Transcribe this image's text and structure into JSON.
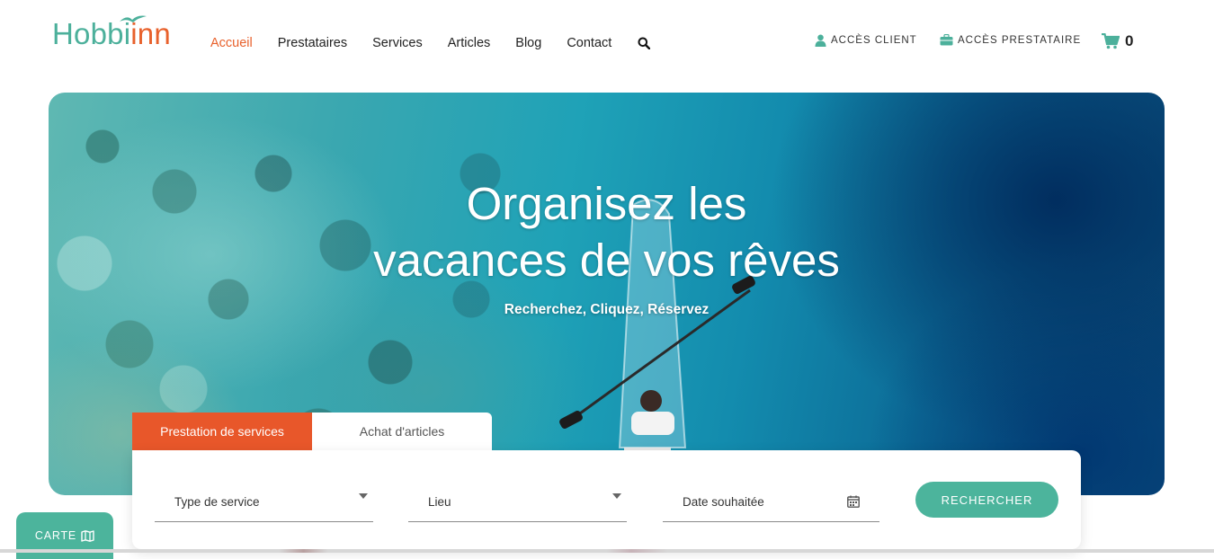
{
  "brand": {
    "logo_part1": "Hobbi",
    "logo_part2": "inn",
    "primary_color": "#4cb09b",
    "accent_color": "#e8612c"
  },
  "nav": {
    "items": [
      {
        "label": "Accueil",
        "active": true
      },
      {
        "label": "Prestataires",
        "active": false
      },
      {
        "label": "Services",
        "active": false
      },
      {
        "label": "Articles",
        "active": false
      },
      {
        "label": "Blog",
        "active": false
      },
      {
        "label": "Contact",
        "active": false
      }
    ],
    "search_icon": "search-icon"
  },
  "account": {
    "client_label": "ACCÈS CLIENT",
    "provider_label": "ACCÈS PRESTATAIRE",
    "cart_count": "0"
  },
  "hero": {
    "title_line1": "Organisez les",
    "title_line2": "vacances de vos rêves",
    "subtitle": "Recherchez, Cliquez, Réservez"
  },
  "search": {
    "tabs": [
      {
        "label": "Prestation de services",
        "active": true
      },
      {
        "label": "Achat d'articles",
        "active": false
      }
    ],
    "fields": {
      "type_placeholder": "Type de service",
      "lieu_placeholder": "Lieu",
      "date_placeholder": "Date souhaitée"
    },
    "button_label": "RECHERCHER"
  },
  "map_button": {
    "label": "CARTE"
  }
}
